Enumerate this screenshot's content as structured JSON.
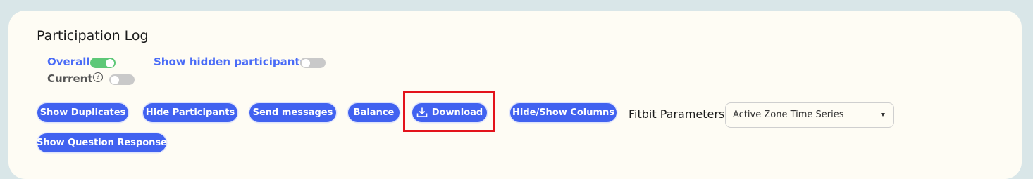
{
  "header": {
    "title": "Participation Log"
  },
  "toggles": {
    "overall": {
      "label": "Overall",
      "on": true
    },
    "current": {
      "label": "Current",
      "on": false,
      "help_glyph": "?"
    },
    "show_hidden": {
      "label": "Show hidden participants",
      "on": false
    }
  },
  "buttons": {
    "show_duplicates": "Show Duplicates",
    "hide_participants": "Hide Participants",
    "send_messages": "Send messages",
    "balance": "Balance",
    "download": "Download",
    "hide_show_columns": "Hide/Show Columns",
    "show_question_response": "Show Question Response"
  },
  "fitbit": {
    "label": "Fitbit Parameters",
    "selected": "Active Zone Time Series"
  },
  "icons": {
    "download": "download-tray-icon",
    "help": "question-circle-icon",
    "select_caret": "caret-down-icon"
  },
  "colors": {
    "button_bg": "#4162f0",
    "toggle_on": "#5dc877",
    "toggle_off": "#c9c9c9",
    "link_blue": "#4a6cf7",
    "highlight": "#e3131b",
    "card_bg": "#fefcf4"
  }
}
